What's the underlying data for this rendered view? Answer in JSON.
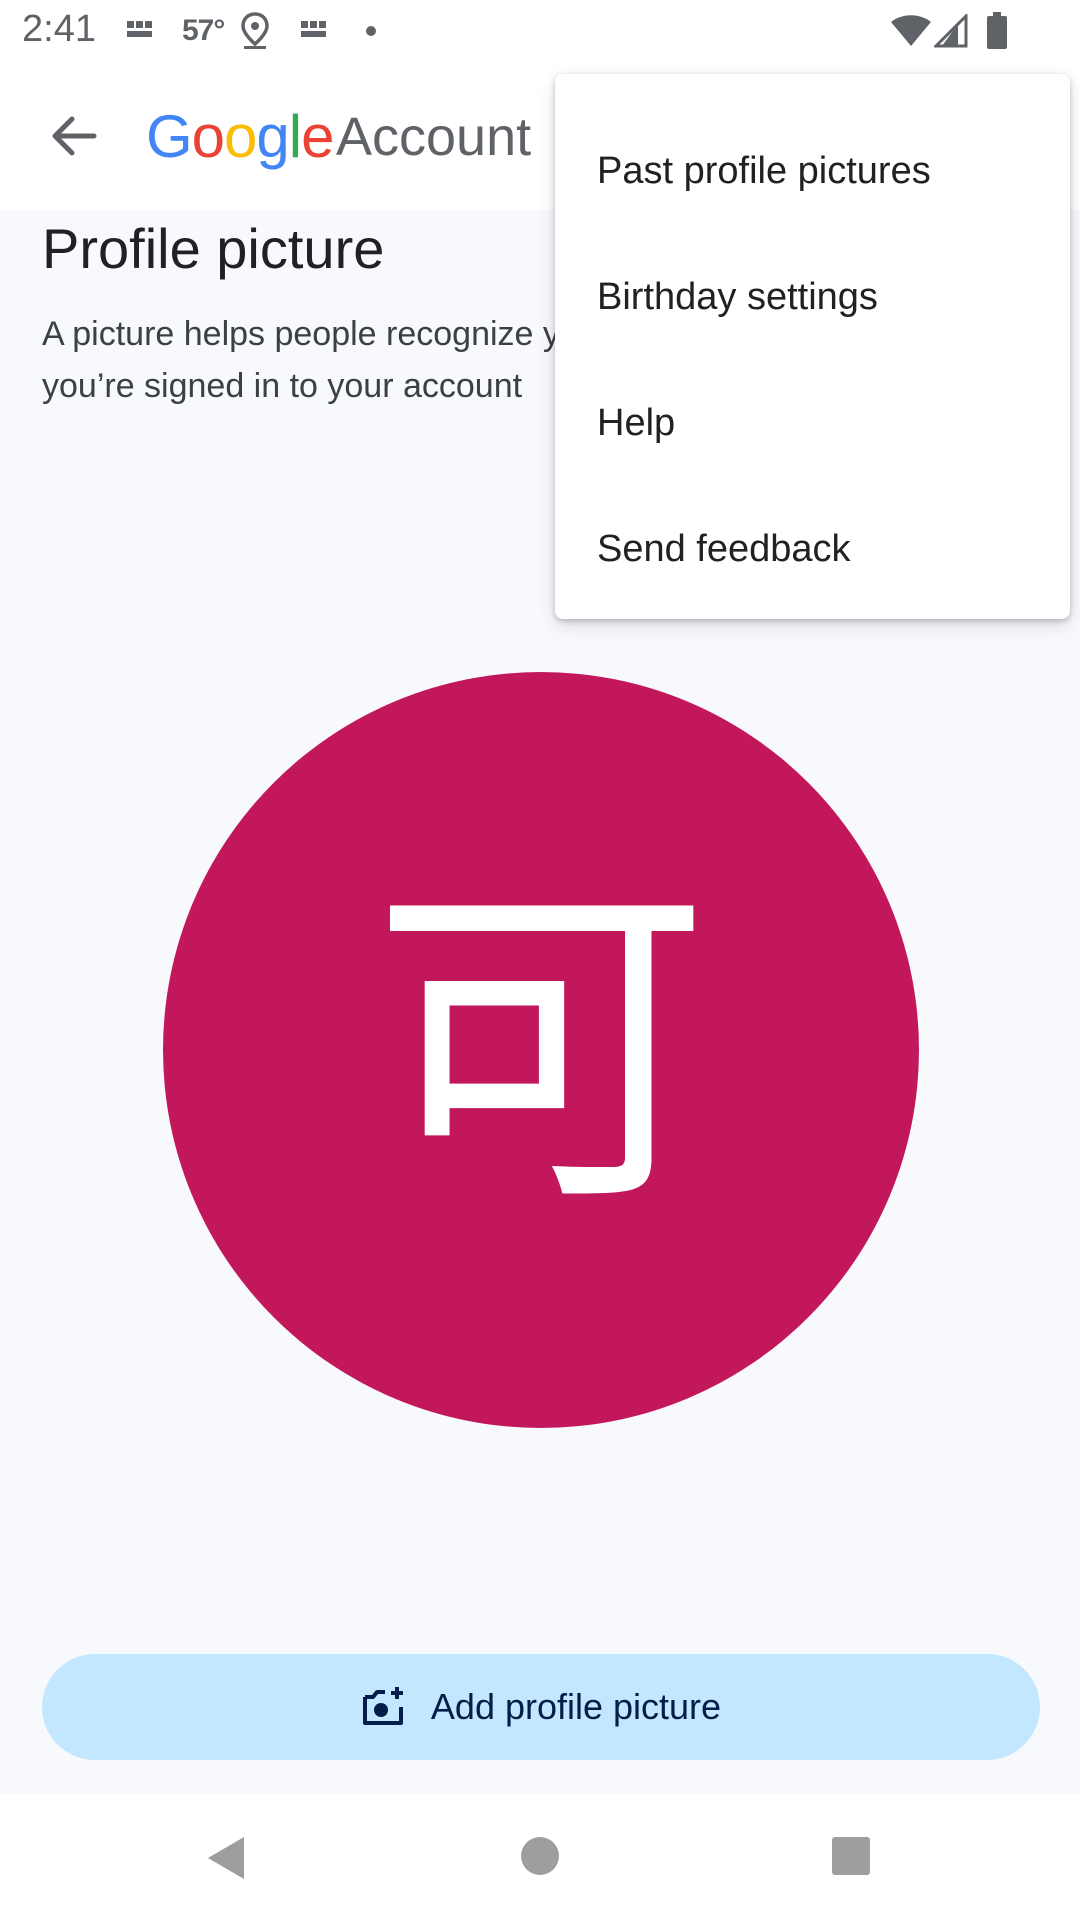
{
  "status_bar": {
    "time": "2:41",
    "news_label": "BBC NEWS",
    "temperature": "57°"
  },
  "app_bar": {
    "logo_letters": [
      {
        "char": "G",
        "color": "#4285F4"
      },
      {
        "char": "o",
        "color": "#EA4335"
      },
      {
        "char": "o",
        "color": "#FBBC05"
      },
      {
        "char": "g",
        "color": "#4285F4"
      },
      {
        "char": "l",
        "color": "#34A853"
      },
      {
        "char": "e",
        "color": "#EA4335"
      }
    ],
    "account_word": "Account"
  },
  "page": {
    "title": "Profile picture",
    "description": "A picture helps people recognize you and lets you know when you’re signed in to your account"
  },
  "avatar": {
    "initial": "可",
    "color": "#c2185b"
  },
  "add_button": {
    "label": "Add profile picture",
    "icon": "add-a-photo-icon"
  },
  "overflow_menu": {
    "items": [
      {
        "label": "Past profile pictures"
      },
      {
        "label": "Birthday settings"
      },
      {
        "label": "Help"
      },
      {
        "label": "Send feedback"
      }
    ]
  },
  "colors": {
    "content_bg": "#f8f9fd",
    "button_bg": "#c2e7ff",
    "button_text": "#041e49"
  }
}
